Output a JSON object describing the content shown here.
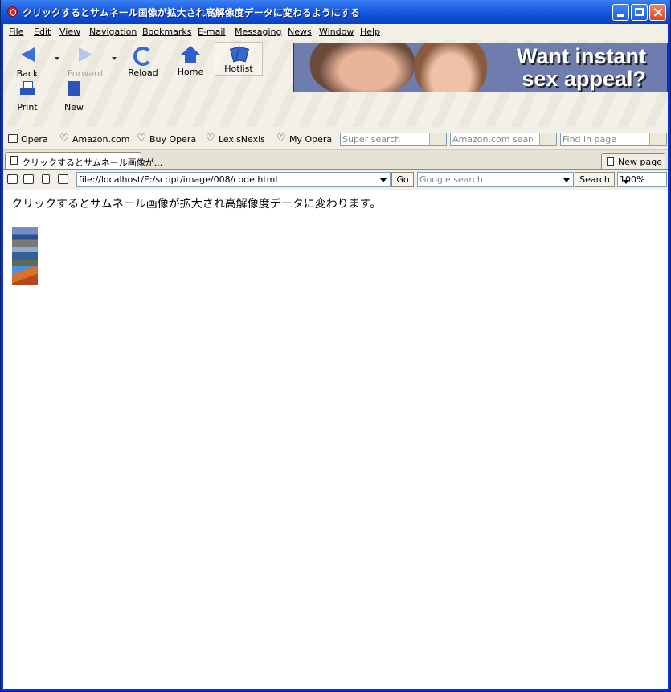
{
  "window": {
    "title": "クリックするとサムネール画像が拡大され高解像度データに変わるようにする"
  },
  "menu": [
    "File",
    "Edit",
    "View",
    "Navigation",
    "Bookmarks",
    "E-mail",
    "Messaging",
    "News",
    "Window",
    "Help"
  ],
  "toolbar": {
    "back": "Back",
    "forward": "Forward",
    "reload": "Reload",
    "home": "Home",
    "hotlist": "Hotlist",
    "print": "Print",
    "new": "New"
  },
  "banner": {
    "line1": "Want instant",
    "line2": "sex appeal?"
  },
  "bookmarks": [
    "Opera",
    "Amazon.com",
    "Buy Opera",
    "LexisNexis",
    "My Opera"
  ],
  "search_fields": {
    "super": "Super search",
    "amazon": "Amazon.com search",
    "find": "Find in page"
  },
  "tabs": {
    "active": "クリックするとサムネール画像が...",
    "new_page": "New page"
  },
  "address": {
    "url": "file://localhost/E:/script/image/008/code.html",
    "go": "Go",
    "google_placeholder": "Google search",
    "search": "Search",
    "zoom": "100%"
  },
  "page": {
    "text": "クリックするとサムネール画像が拡大され高解像度データに変わります。",
    "thumbnails": [
      "thumbnail-coast",
      "thumbnail-sea",
      "thumbnail-desert"
    ]
  },
  "colors": {
    "titlebar": "#0b4bd2",
    "chrome": "#f1efe6",
    "accent_icon": "#3e6fd6"
  }
}
